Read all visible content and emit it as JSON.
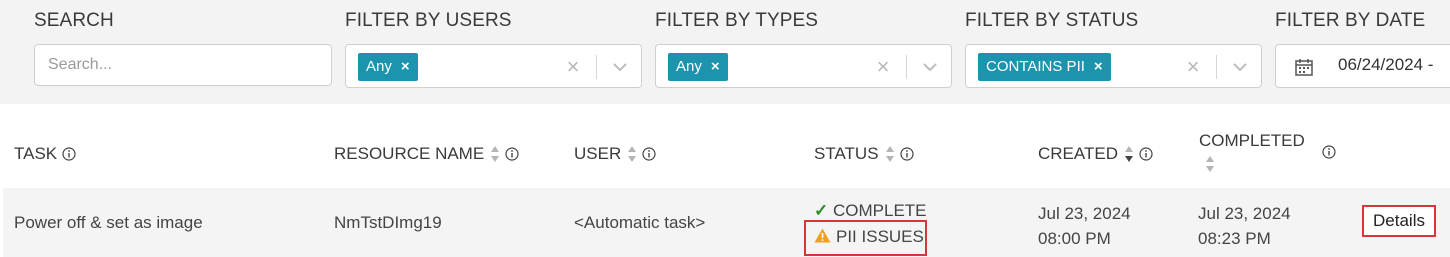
{
  "filters": {
    "search": {
      "label": "SEARCH",
      "placeholder": "Search..."
    },
    "users": {
      "label": "FILTER BY USERS",
      "chip": "Any"
    },
    "types": {
      "label": "FILTER BY TYPES",
      "chip": "Any"
    },
    "status": {
      "label": "FILTER BY STATUS",
      "chip": "CONTAINS PII"
    },
    "date": {
      "label": "FILTER BY DATE",
      "value": "06/24/2024 -"
    },
    "chip_remove": "×",
    "clear": "×"
  },
  "table": {
    "headers": {
      "task": "TASK",
      "resource_name": "RESOURCE NAME",
      "user": "USER",
      "status": "STATUS",
      "created": "CREATED",
      "completed": "COMPLETED"
    },
    "rows": [
      {
        "task": "Power off & set as image",
        "resource_name": "NmTstDImg19",
        "user": "<Automatic task>",
        "status": "COMPLETE",
        "status_check": "✓",
        "status_warning": "PII ISSUES",
        "created_date": "Jul 23, 2024",
        "created_time": "08:00 PM",
        "completed_date": "Jul 23, 2024",
        "completed_time": "08:23 PM",
        "action": "Details"
      }
    ]
  },
  "colors": {
    "chip": "#1d94ad",
    "highlight": "#d9343a",
    "success": "#2e8b2e",
    "warning": "#f0a020"
  }
}
